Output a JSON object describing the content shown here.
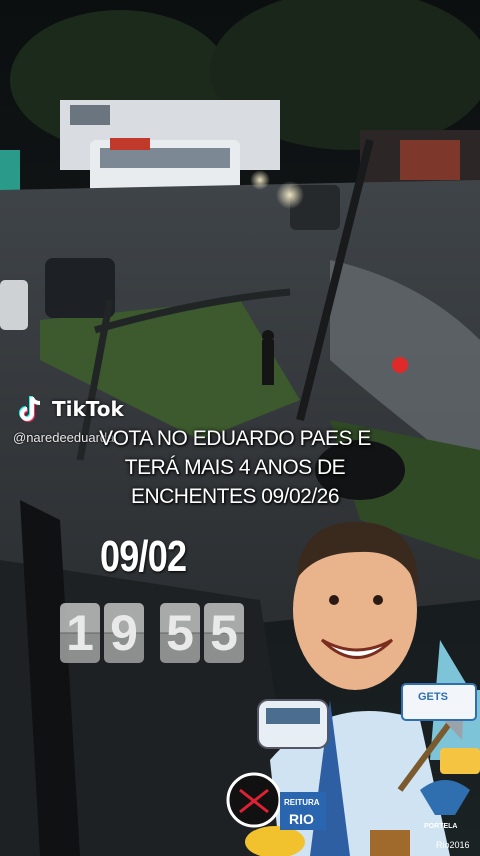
{
  "watermark": {
    "brand": "TikTok",
    "handle": "@naredeeduarda"
  },
  "caption": {
    "line1": "VOTA NO EDUARDO PAES E",
    "line2": "TERÁ MAIS 4 ANOS DE",
    "line3": "ENCHENTES 09/02/26"
  },
  "overlay": {
    "date": "09/02",
    "time_digits": [
      "1",
      "9",
      "5",
      "5"
    ]
  },
  "signs": {
    "gets": "GETS",
    "prefeitura": "REITURA",
    "rio": "RIO",
    "portela": "PORTELA",
    "rio2016": "Rio2016"
  },
  "colors": {
    "water": "#4a4f55",
    "tiktok_cyan": "#25f4ee",
    "tiktok_red": "#fe2c55"
  }
}
